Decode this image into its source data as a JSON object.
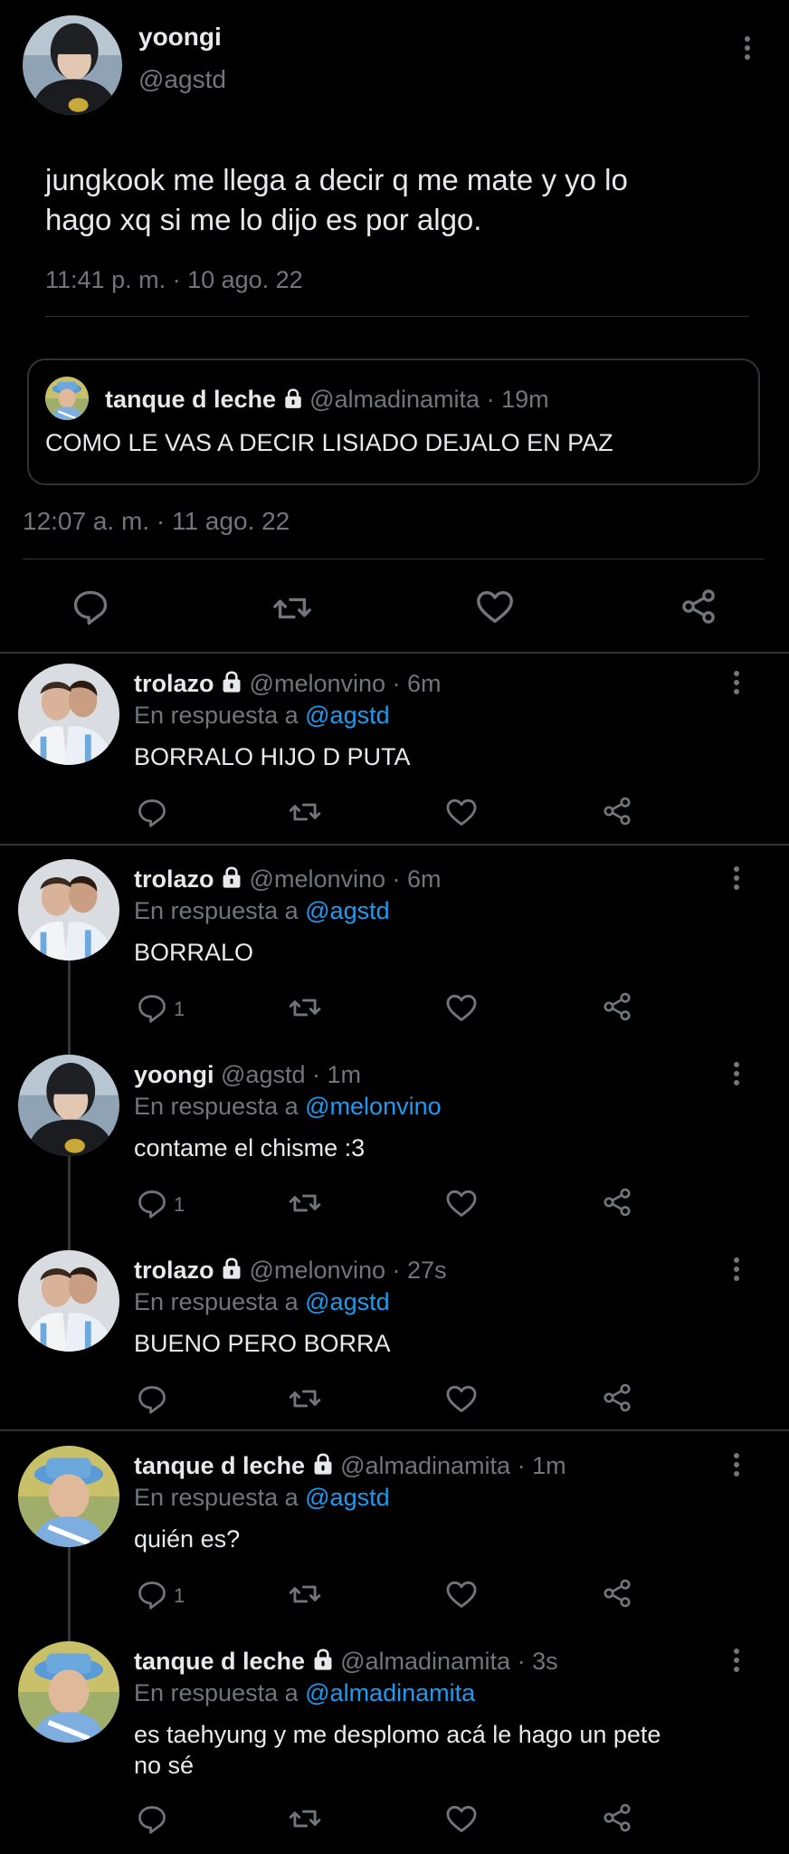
{
  "main_tweet": {
    "author_name": "yoongi",
    "author_handle": "@agstd",
    "text_line1": "jungkook me llega a decir q me mate y yo lo",
    "text_line2": "hago xq si me lo dijo es por algo.",
    "timestamp": "11:41 p. m. · 10 ago. 22"
  },
  "quote_tweet": {
    "author_name": "tanque d leche",
    "author_handle": "@almadinamita",
    "age": "· 19m",
    "text": "COMO LE VAS A DECIR LISIADO DEJALO EN PAZ",
    "timestamp": "12:07 a. m. · 11 ago. 22"
  },
  "replies": [
    {
      "name": "trolazo",
      "handle": "@melonvino",
      "age": "· 6m",
      "reply_prefix": "En respuesta a",
      "reply_to": "@agstd",
      "text_lines": [
        "BORRALO HIJO D PUTA"
      ],
      "reply_count": ""
    },
    {
      "name": "trolazo",
      "handle": "@melonvino",
      "age": "· 6m",
      "reply_prefix": "En respuesta a",
      "reply_to": "@agstd",
      "text_lines": [
        "BORRALO"
      ],
      "reply_count": "1"
    },
    {
      "name": "yoongi",
      "handle": "@agstd",
      "age": "· 1m",
      "reply_prefix": "En respuesta a",
      "reply_to": "@melonvino",
      "text_lines": [
        "contame el chisme :3"
      ],
      "reply_count": "1"
    },
    {
      "name": "trolazo",
      "handle": "@melonvino",
      "age": "· 27s",
      "reply_prefix": "En respuesta a",
      "reply_to": "@agstd",
      "text_lines": [
        "BUENO PERO BORRA"
      ],
      "reply_count": ""
    },
    {
      "name": "tanque d leche",
      "handle": "@almadinamita",
      "age": "· 1m",
      "reply_prefix": "En respuesta a",
      "reply_to": "@agstd",
      "text_lines": [
        "quién es?"
      ],
      "reply_count": "1"
    },
    {
      "name": "tanque d leche",
      "handle": "@almadinamita",
      "age": "· 3s",
      "reply_prefix": "En respuesta a",
      "reply_to": "@almadinamita",
      "text_lines": [
        "es taehyung y me desplomo acá le hago un pete",
        "no sé"
      ],
      "reply_count": ""
    }
  ],
  "icons": [
    "reply-icon",
    "retweet-icon",
    "like-icon",
    "share-icon",
    "lock-icon",
    "more-icon"
  ],
  "colors": {
    "background": "#000000",
    "text": "#e7e9ea",
    "secondary": "#71767b",
    "link": "#1d9bf0",
    "divider": "#2f3336"
  }
}
